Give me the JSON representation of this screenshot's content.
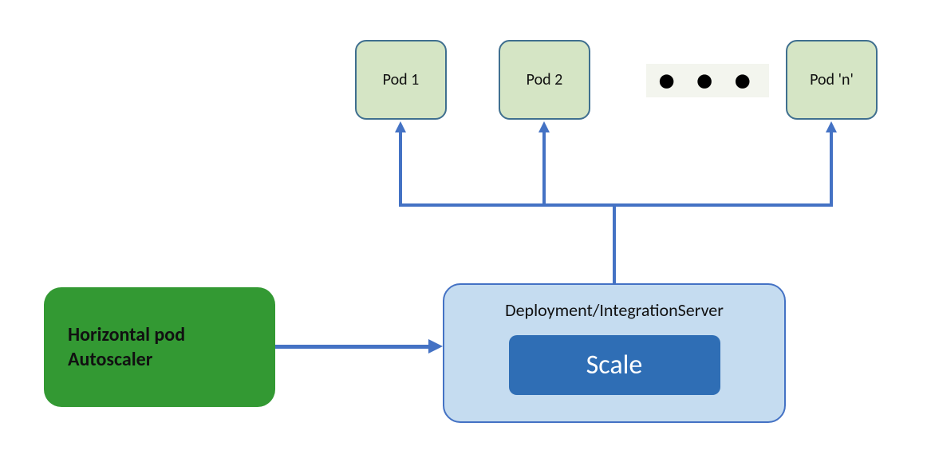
{
  "pods": {
    "p1": "Pod 1",
    "p2": "Pod 2",
    "pn": "Pod 'n'"
  },
  "ellipsis": "● ● ●",
  "hpa": {
    "line1": "Horizontal pod",
    "line2": "Autoscaler"
  },
  "deployment": {
    "title": "Deployment/IntegrationServer",
    "scale_label": "Scale"
  }
}
